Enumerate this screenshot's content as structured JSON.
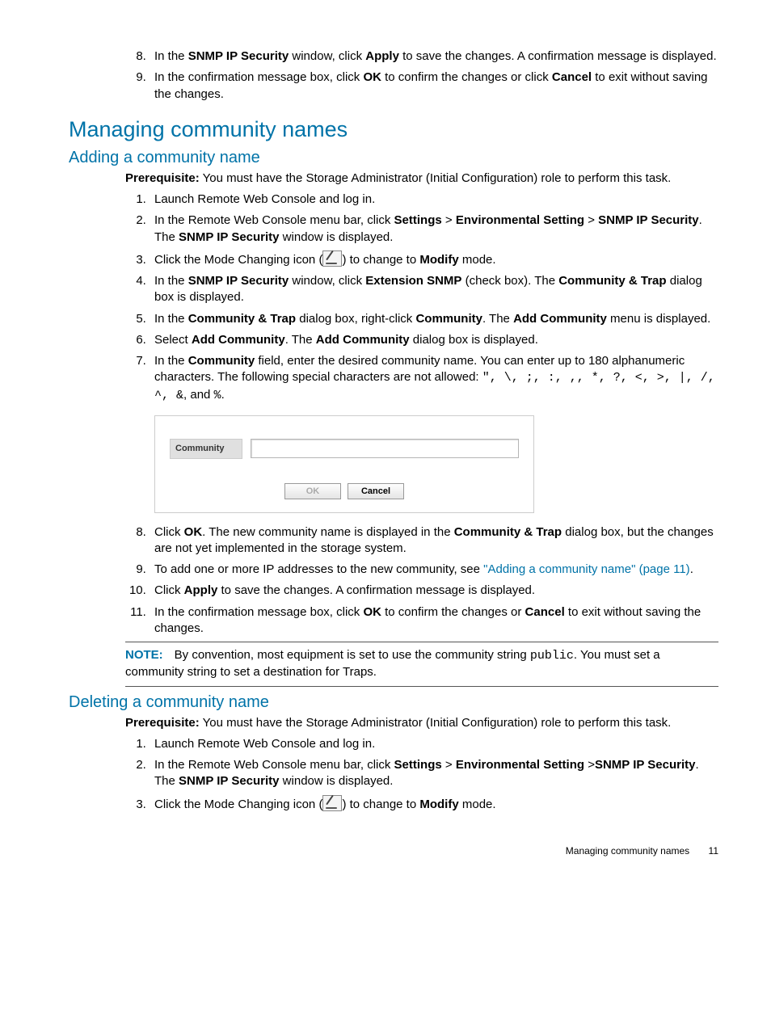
{
  "top_steps": {
    "s8_a": "In the ",
    "s8_b": "SNMP IP Security",
    "s8_c": " window, click ",
    "s8_d": "Apply",
    "s8_e": " to save the changes. A confirmation message is displayed.",
    "s9_a": "In the confirmation message box, click ",
    "s9_b": "OK",
    "s9_c": " to confirm the changes or click ",
    "s9_d": "Cancel",
    "s9_e": " to exit without saving the changes."
  },
  "section_managing": "Managing community names",
  "adding": {
    "heading": "Adding a community name",
    "prereq_label": "Prerequisite:",
    "prereq_text": " You must have the Storage Administrator (Initial Configuration) role to perform this task.",
    "s1": "Launch Remote Web Console and log in.",
    "s2_a": "In the Remote Web Console menu bar, click ",
    "s2_b": "Settings",
    "s2_gt": " > ",
    "s2_c": "Environmental Setting",
    "s2_d": "SNMP IP Security",
    "s2_e": ". The ",
    "s2_f": "SNMP IP Security",
    "s2_g": " window is displayed.",
    "s3_a": "Click the Mode Changing icon (",
    "s3_b": ") to change to ",
    "s3_c": "Modify",
    "s3_d": " mode.",
    "s4_a": "In the ",
    "s4_b": "SNMP IP Security",
    "s4_c": " window, click ",
    "s4_d": "Extension SNMP",
    "s4_e": " (check box). The ",
    "s4_f": "Community & Trap",
    "s4_g": " dialog box is displayed.",
    "s5_a": "In the ",
    "s5_b": "Community & Trap",
    "s5_c": " dialog box, right-click ",
    "s5_d": "Community",
    "s5_e": ". The ",
    "s5_f": "Add Community",
    "s5_g": " menu is displayed.",
    "s6_a": "Select ",
    "s6_b": "Add Community",
    "s6_c": ". The ",
    "s6_d": "Add Community",
    "s6_e": " dialog box is displayed.",
    "s7_a": "In the ",
    "s7_b": "Community",
    "s7_c": " field, enter the desired community name. You can enter up to 180 alphanumeric characters. The following special characters are not allowed: ",
    "s7_chars": "\", \\, ;, :, ,, *, ?, <, >, |, /, ^, &",
    "s7_and": ", and ",
    "s7_pct": "%",
    "s7_dot": ".",
    "s8_a": "Click ",
    "s8_b": "OK",
    "s8_c": ". The new community name is displayed in the ",
    "s8_d": "Community & Trap",
    "s8_e": " dialog box, but the changes are not yet implemented in the storage system.",
    "s9_a": "To add one or more IP addresses to the new community, see ",
    "s9_link": "\"Adding a community name\" (page 11)",
    "s9_dot": ".",
    "s10_a": "Click ",
    "s10_b": "Apply",
    "s10_c": " to save the changes. A confirmation message is displayed.",
    "s11_a": "In the confirmation message box, click ",
    "s11_b": "OK",
    "s11_c": " to confirm the changes or ",
    "s11_d": "Cancel",
    "s11_e": " to exit without saving the changes.",
    "note_label": "NOTE:",
    "note_a": "By convention, most equipment is set to use the community string ",
    "note_code": "public",
    "note_b": ". You must set a community string to set a destination for Traps."
  },
  "dialog": {
    "label": "Community",
    "input_value": "",
    "ok": "OK",
    "cancel": "Cancel"
  },
  "deleting": {
    "heading": "Deleting a community name",
    "prereq_label": "Prerequisite:",
    "prereq_text": " You must have the Storage Administrator (Initial Configuration) role to perform this task.",
    "s1": "Launch Remote Web Console and log in.",
    "s2_a": "In the Remote Web Console menu bar, click ",
    "s2_b": "Settings",
    "s2_gt": " > ",
    "s2_c": "Environmental Setting",
    "s2_gt2": " >",
    "s2_d": "SNMP IP Security",
    "s2_e": ". The ",
    "s2_f": "SNMP IP Security",
    "s2_g": " window is displayed.",
    "s3_a": "Click the Mode Changing icon (",
    "s3_b": ") to change to ",
    "s3_c": "Modify",
    "s3_d": " mode."
  },
  "footer": {
    "text": "Managing community names",
    "page": "11"
  }
}
